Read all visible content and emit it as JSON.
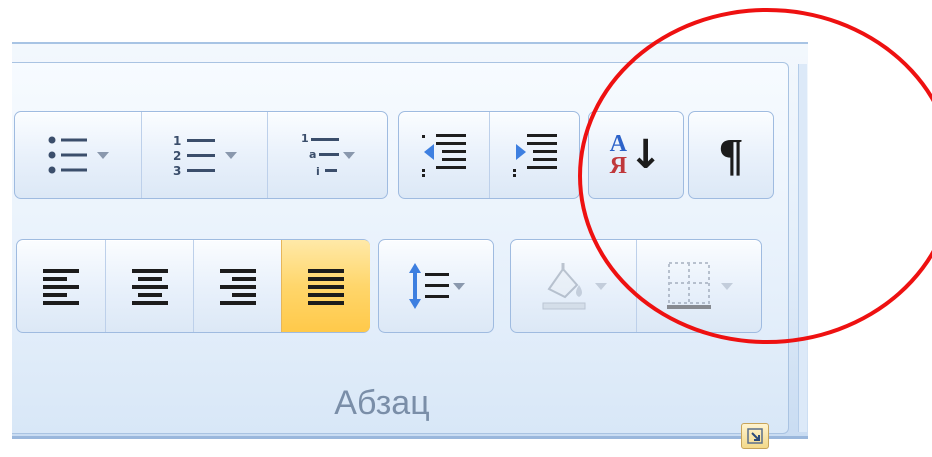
{
  "ribbon": {
    "group_label": "Абзац",
    "row1": [
      {
        "name": "bullets",
        "icon": "bullet-list-icon",
        "has_dropdown": true
      },
      {
        "name": "numbering",
        "icon": "numbered-list-icon",
        "has_dropdown": true
      },
      {
        "name": "multilevel-list",
        "icon": "multilevel-list-icon",
        "has_dropdown": true
      },
      {
        "name": "decrease-indent",
        "icon": "decrease-indent-icon"
      },
      {
        "name": "increase-indent",
        "icon": "increase-indent-icon"
      },
      {
        "name": "sort",
        "icon": "sort-icon",
        "glyph_top": "А",
        "glyph_bottom": "Я",
        "arrow": "↓"
      },
      {
        "name": "show-formatting-marks",
        "icon": "pilcrow-icon",
        "glyph": "¶"
      }
    ],
    "row2": [
      {
        "name": "align-left",
        "icon": "align-left-icon"
      },
      {
        "name": "align-center",
        "icon": "align-center-icon"
      },
      {
        "name": "align-right",
        "icon": "align-right-icon"
      },
      {
        "name": "justify",
        "icon": "justify-icon",
        "selected": true
      },
      {
        "name": "line-spacing",
        "icon": "line-spacing-icon",
        "has_dropdown": true
      },
      {
        "name": "shading",
        "icon": "shading-icon",
        "has_dropdown": true,
        "disabled": true
      },
      {
        "name": "borders",
        "icon": "borders-icon",
        "has_dropdown": true,
        "disabled": true
      }
    ]
  },
  "colors": {
    "highlight_circle": "#ee1111",
    "selected_button": "#ffd66b",
    "ribbon_bg": "#e3eefa"
  }
}
